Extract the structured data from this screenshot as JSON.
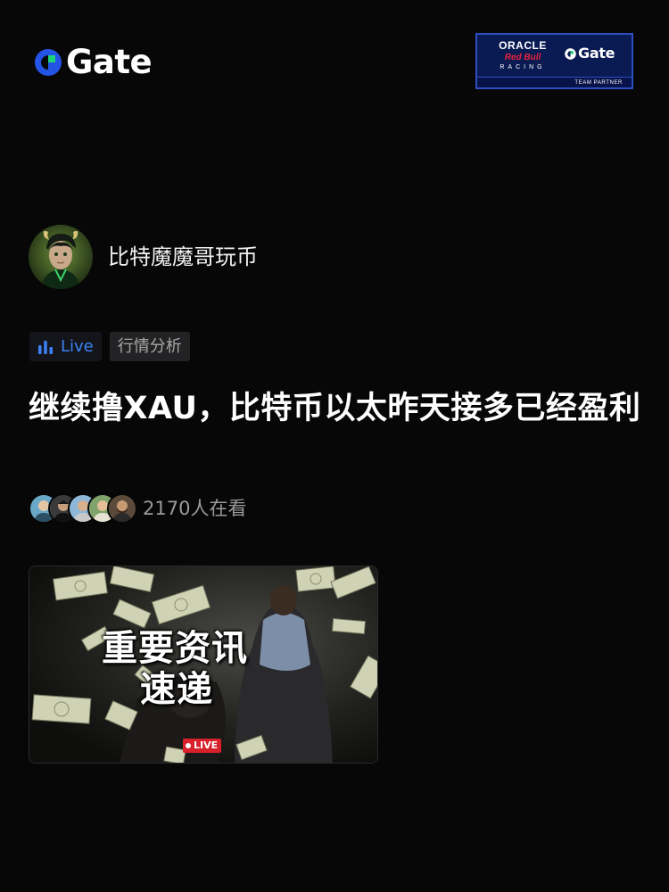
{
  "brand": {
    "logo_text": "Gate",
    "accent_color": "#2354e6",
    "logo_green": "#1fd37a"
  },
  "partner_badge": {
    "oracle": "ORACLE",
    "redbull": "Red Bull",
    "racing": "RACING",
    "gate": "Gate",
    "footer": "TEAM PARTNER"
  },
  "author": {
    "name": "比特魔魔哥玩币",
    "avatar_icon": "avatar-horned-character-icon"
  },
  "tags": {
    "live_label": "Live",
    "live_icon": "bar-chart-icon",
    "category": "行情分析"
  },
  "post": {
    "title": "继续撸XAU，比特币以太昨天接多已经盈利"
  },
  "viewers": {
    "count_text": "2170人在看",
    "avatar_count": 5
  },
  "live_card": {
    "cover_line_1": "重要资讯",
    "cover_line_2": "速递",
    "badge": "LIVE",
    "live_color": "#d8212b"
  }
}
